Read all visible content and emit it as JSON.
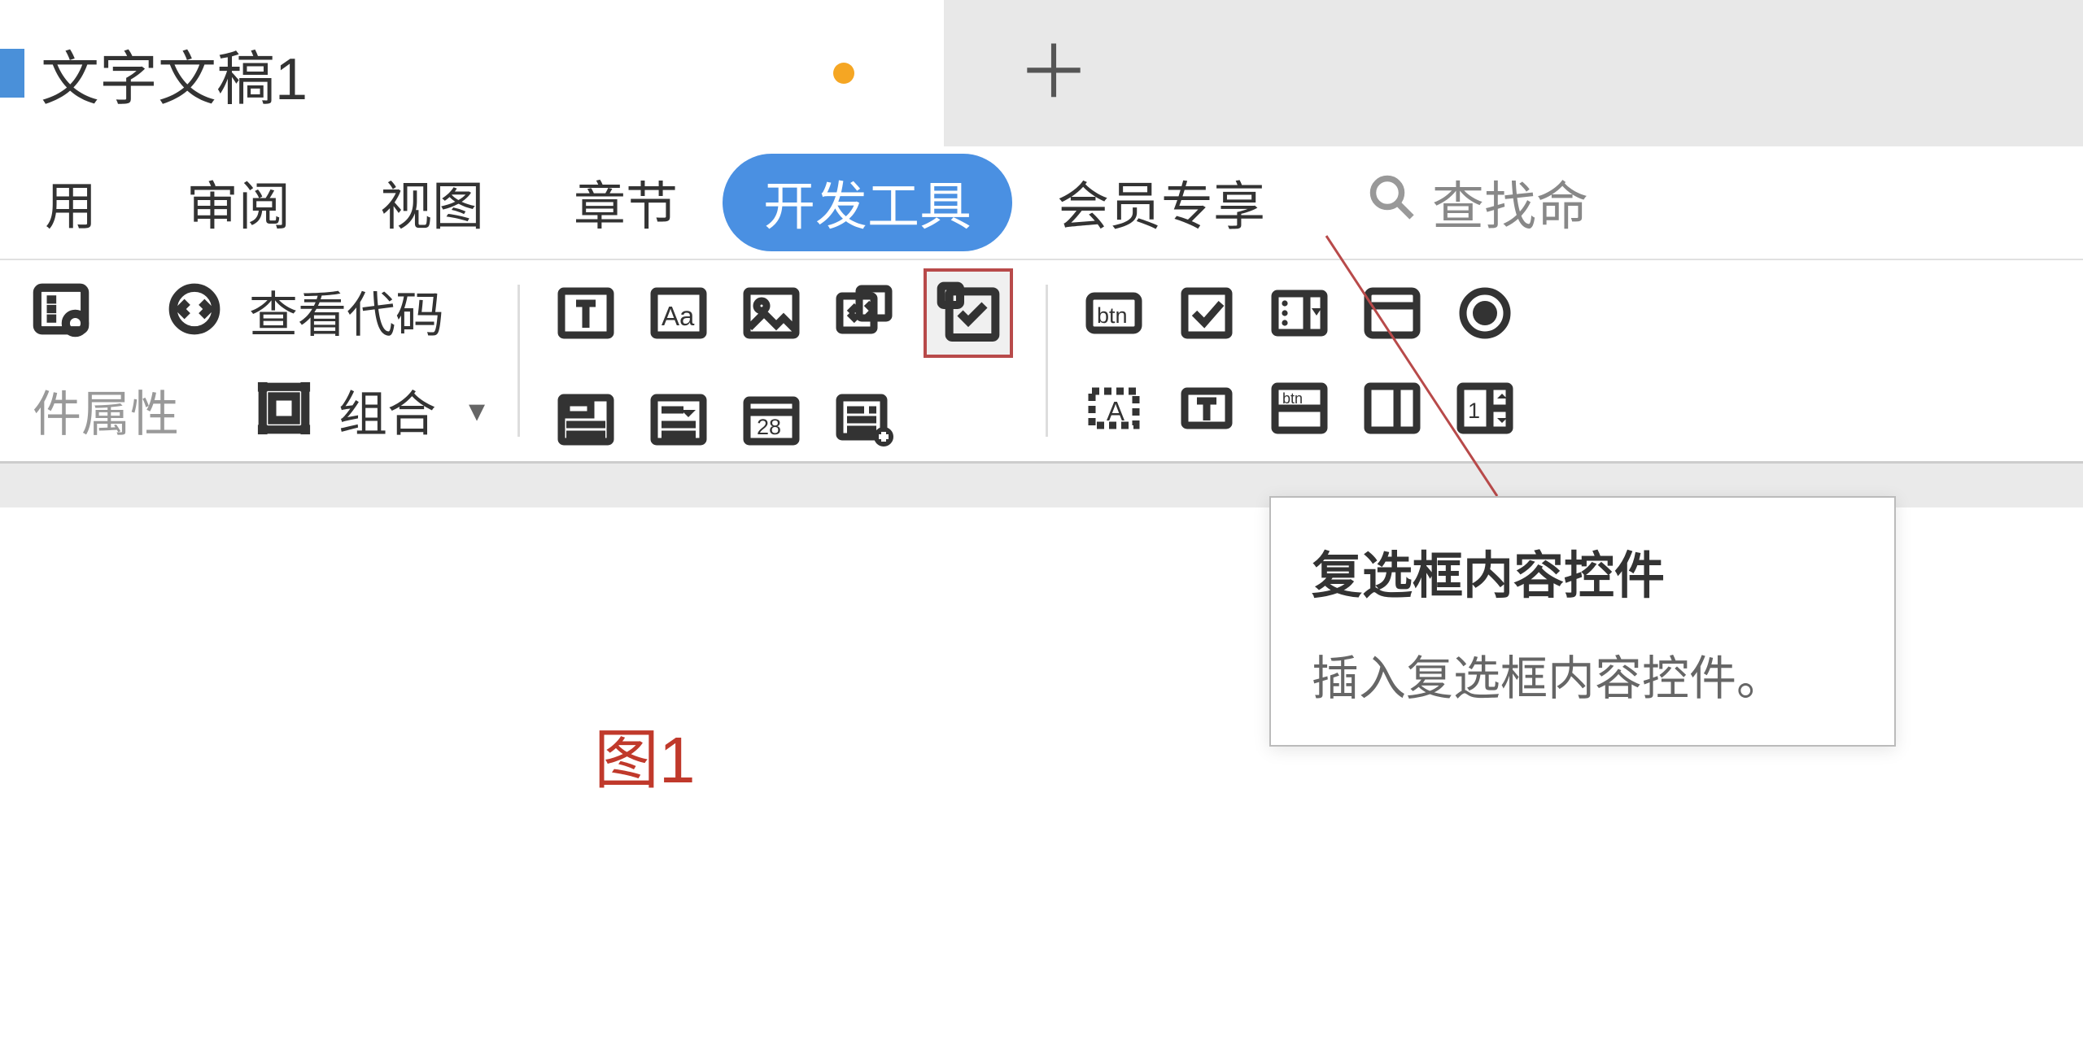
{
  "tab": {
    "doc_title": "文字文稿1",
    "plus": "＋"
  },
  "menu": {
    "items": [
      "用",
      "审阅",
      "视图",
      "章节",
      "开发工具",
      "会员专享"
    ],
    "active_index": 4,
    "search_label": "查找命"
  },
  "ribbon": {
    "group1": {
      "properties_label": "件属性",
      "view_code_label": "查看代码",
      "group_label": "组合"
    }
  },
  "tooltip": {
    "title": "复选框内容控件",
    "desc": "插入复选框内容控件。"
  },
  "figure_label": "图1"
}
